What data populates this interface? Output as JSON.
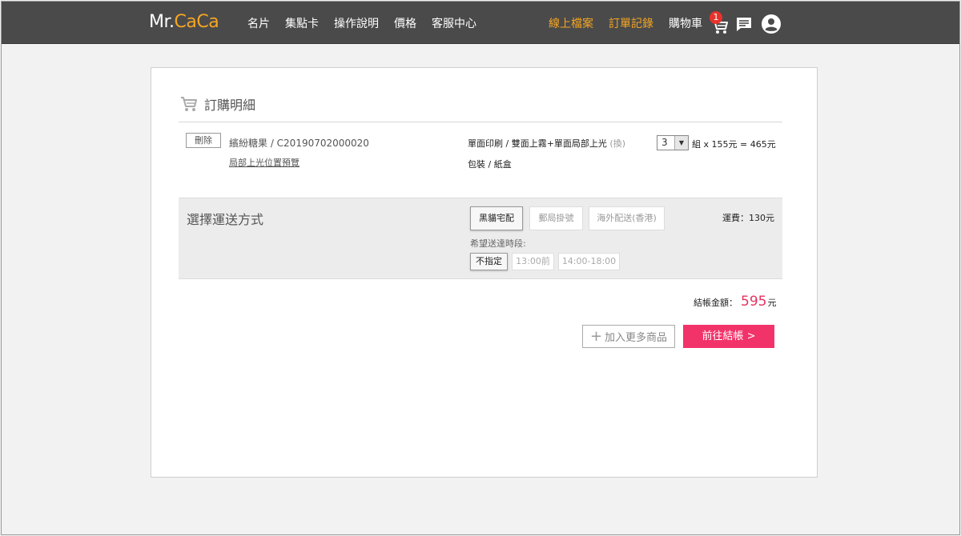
{
  "navbar": {
    "logo_prefix": "Mr.",
    "logo_brand": "CaCa",
    "left_links": [
      "名片",
      "集點卡",
      "操作說明",
      "價格",
      "客服中心"
    ],
    "online_files": "線上檔案",
    "order_records": "訂單記錄",
    "cart_label": "購物車",
    "cart_count": "1",
    "icons": [
      "cart-icon",
      "chat-icon",
      "account-icon"
    ],
    "accent_color": "#f5a623"
  },
  "order": {
    "title": "訂購明細",
    "delete_label": "刪除",
    "item_name": "繽紛糖果 / C20190702000020",
    "preview_link": "局部上光位置預覽",
    "spec_main": "單面印刷 / 雙面上霧+單面局部上光",
    "spec_note": "(換)",
    "packaging": "包裝 / 紙盒",
    "quantity": "3",
    "price_line": "組 x 155元 = 465元"
  },
  "shipping": {
    "title": "選擇運送方式",
    "options": [
      "黑貓宅配",
      "郵局掛號",
      "海外配送(香港)"
    ],
    "selected_option": "黑貓宅配",
    "fee": "運費：130元",
    "time_label": "希望送達時段:",
    "time_options": [
      "不指定",
      "13:00前",
      "14:00-18:00"
    ],
    "selected_time": "不指定"
  },
  "summary": {
    "total_label": "結帳金額：",
    "total_amount": "595",
    "total_unit": "元",
    "total_color": "#e6335e",
    "add_more_label": "加入更多商品",
    "checkout_label": "前往結帳 >",
    "checkout_color": "#f2336a"
  }
}
